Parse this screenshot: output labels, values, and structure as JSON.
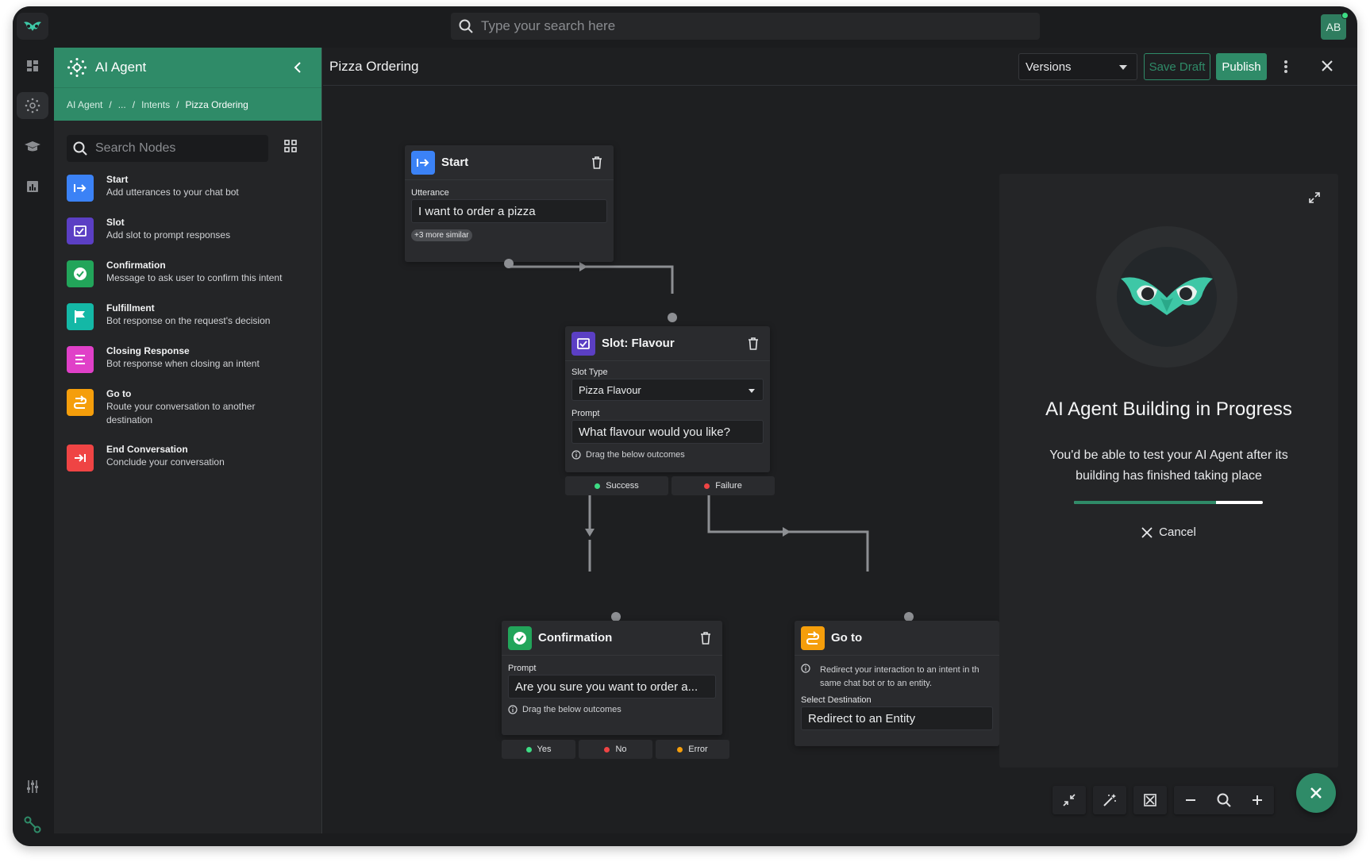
{
  "topbar": {
    "search_placeholder": "Type your search here",
    "avatar_initials": "AB"
  },
  "sidebar": {
    "title": "AI Agent",
    "breadcrumbs": [
      "AI Agent",
      "...",
      "Intents",
      "Pizza Ordering"
    ],
    "search_placeholder": "Search Nodes",
    "items": [
      {
        "name": "Start",
        "desc": "Add utterances to your chat bot",
        "color": "#3b82f6",
        "icon": "start-icon"
      },
      {
        "name": "Slot",
        "desc": "Add slot to prompt responses",
        "color": "#5b3fc4",
        "icon": "slot-icon"
      },
      {
        "name": "Confirmation",
        "desc": "Message to ask user to confirm this intent",
        "color": "#22a55a",
        "icon": "check-circle-icon"
      },
      {
        "name": "Fulfillment",
        "desc": "Bot response on the request's decision",
        "color": "#14b8a6",
        "icon": "flag-icon"
      },
      {
        "name": "Closing Response",
        "desc": "Bot response when closing an intent",
        "color": "#e040c8",
        "icon": "list-icon"
      },
      {
        "name": "Go to",
        "desc": "Route your conversation to another destination",
        "color": "#f59e0b",
        "icon": "route-icon"
      },
      {
        "name": "End Conversation",
        "desc": "Conclude your conversation",
        "color": "#ef4444",
        "icon": "end-icon"
      }
    ]
  },
  "main": {
    "title": "Pizza Ordering",
    "versions_label": "Versions",
    "save_draft_label": "Save Draft",
    "publish_label": "Publish"
  },
  "nodes": {
    "start": {
      "title": "Start",
      "utterance_label": "Utterance",
      "utterance_value": "I want to order a pizza",
      "more_similar": "+3 more similar"
    },
    "slot": {
      "title": "Slot: Flavour",
      "slot_type_label": "Slot Type",
      "slot_type_value": "Pizza Flavour",
      "prompt_label": "Prompt",
      "prompt_value": "What flavour would you like?",
      "hint": "Drag the below outcomes",
      "outcomes": [
        {
          "label": "Success",
          "color": "#3ddc84"
        },
        {
          "label": "Failure",
          "color": "#ef4444"
        }
      ]
    },
    "confirmation": {
      "title": "Confirmation",
      "prompt_label": "Prompt",
      "prompt_value": "Are you sure you want to order a...",
      "hint": "Drag the below outcomes",
      "outcomes": [
        {
          "label": "Yes",
          "color": "#3ddc84"
        },
        {
          "label": "No",
          "color": "#ef4444"
        },
        {
          "label": "Error",
          "color": "#f59e0b"
        }
      ]
    },
    "goto": {
      "title": "Go to",
      "info_line1": "Redirect your interaction to an intent in th",
      "info_line2": "same chat bot or to an entity.",
      "destination_label": "Select Destination",
      "destination_value": "Redirect to an Entity"
    }
  },
  "test_panel": {
    "title": "AI Agent Building in Progress",
    "description": "You'd be able to test your AI Agent after its building has finished taking place",
    "progress": 0.75,
    "cancel_label": "Cancel"
  },
  "colors": {
    "brand": "#2f8b68",
    "background": "#1b1c1e"
  }
}
